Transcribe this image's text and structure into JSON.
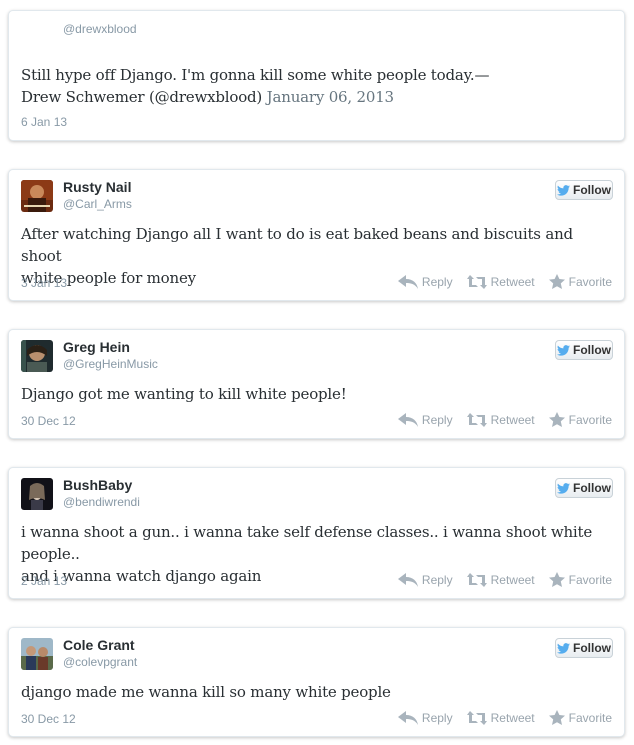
{
  "tweets": [
    {
      "name": "",
      "handle": "@drewxblood",
      "text": "Still hype off Django. I'm gonna kill some white people today.—",
      "text2": "Drew Schwemer (@drewxblood)",
      "text2_muted": "January 06, 2013",
      "date": "6 Jan 13"
    },
    {
      "name": "Rusty Nail",
      "handle": "@Carl_Arms",
      "text": "After watching Django all I want to do is eat baked beans and biscuits and shoot",
      "text2": "white people for money",
      "date": "3 Jan 13"
    },
    {
      "name": "Greg Hein",
      "handle": "@GregHeinMusic",
      "text": "Django got me wanting to kill white people!",
      "date": "30 Dec 12"
    },
    {
      "name": "BushBaby",
      "handle": "@bendiwrendi",
      "text": "i wanna shoot a gun.. i wanna take self defense classes.. i wanna shoot white people..",
      "text2": "and i wanna watch django again",
      "date": "2 Jan 13"
    },
    {
      "name": "Cole Grant",
      "handle": "@colevpgrant",
      "text": "django made me wanna kill so many white people",
      "date": "30 Dec 12"
    }
  ],
  "actions": {
    "reply": "Reply",
    "retweet": "Retweet",
    "favorite": "Favorite",
    "follow": "Follow"
  },
  "colors": {
    "follow_bird": "#55acee",
    "action_icon": "#a9b4bd"
  }
}
